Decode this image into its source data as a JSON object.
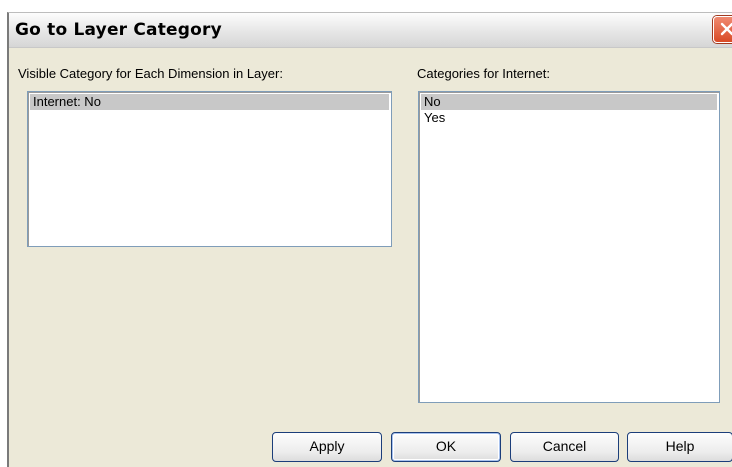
{
  "dialog": {
    "title": "Go to Layer Category",
    "close_icon": "close-icon"
  },
  "left_panel": {
    "label": "Visible Category for Each Dimension in Layer:",
    "items": [
      {
        "text": "Internet: No",
        "selected": true
      }
    ]
  },
  "right_panel": {
    "label": "Categories for Internet:",
    "items": [
      {
        "text": "No",
        "selected": true
      },
      {
        "text": "Yes",
        "selected": false
      }
    ]
  },
  "buttons": {
    "apply": "Apply",
    "ok": "OK",
    "cancel": "Cancel",
    "help": "Help"
  },
  "colors": {
    "dialog_bg": "#ece9d8",
    "selection": "#c8c8c8",
    "close_button": "#d94a25"
  }
}
